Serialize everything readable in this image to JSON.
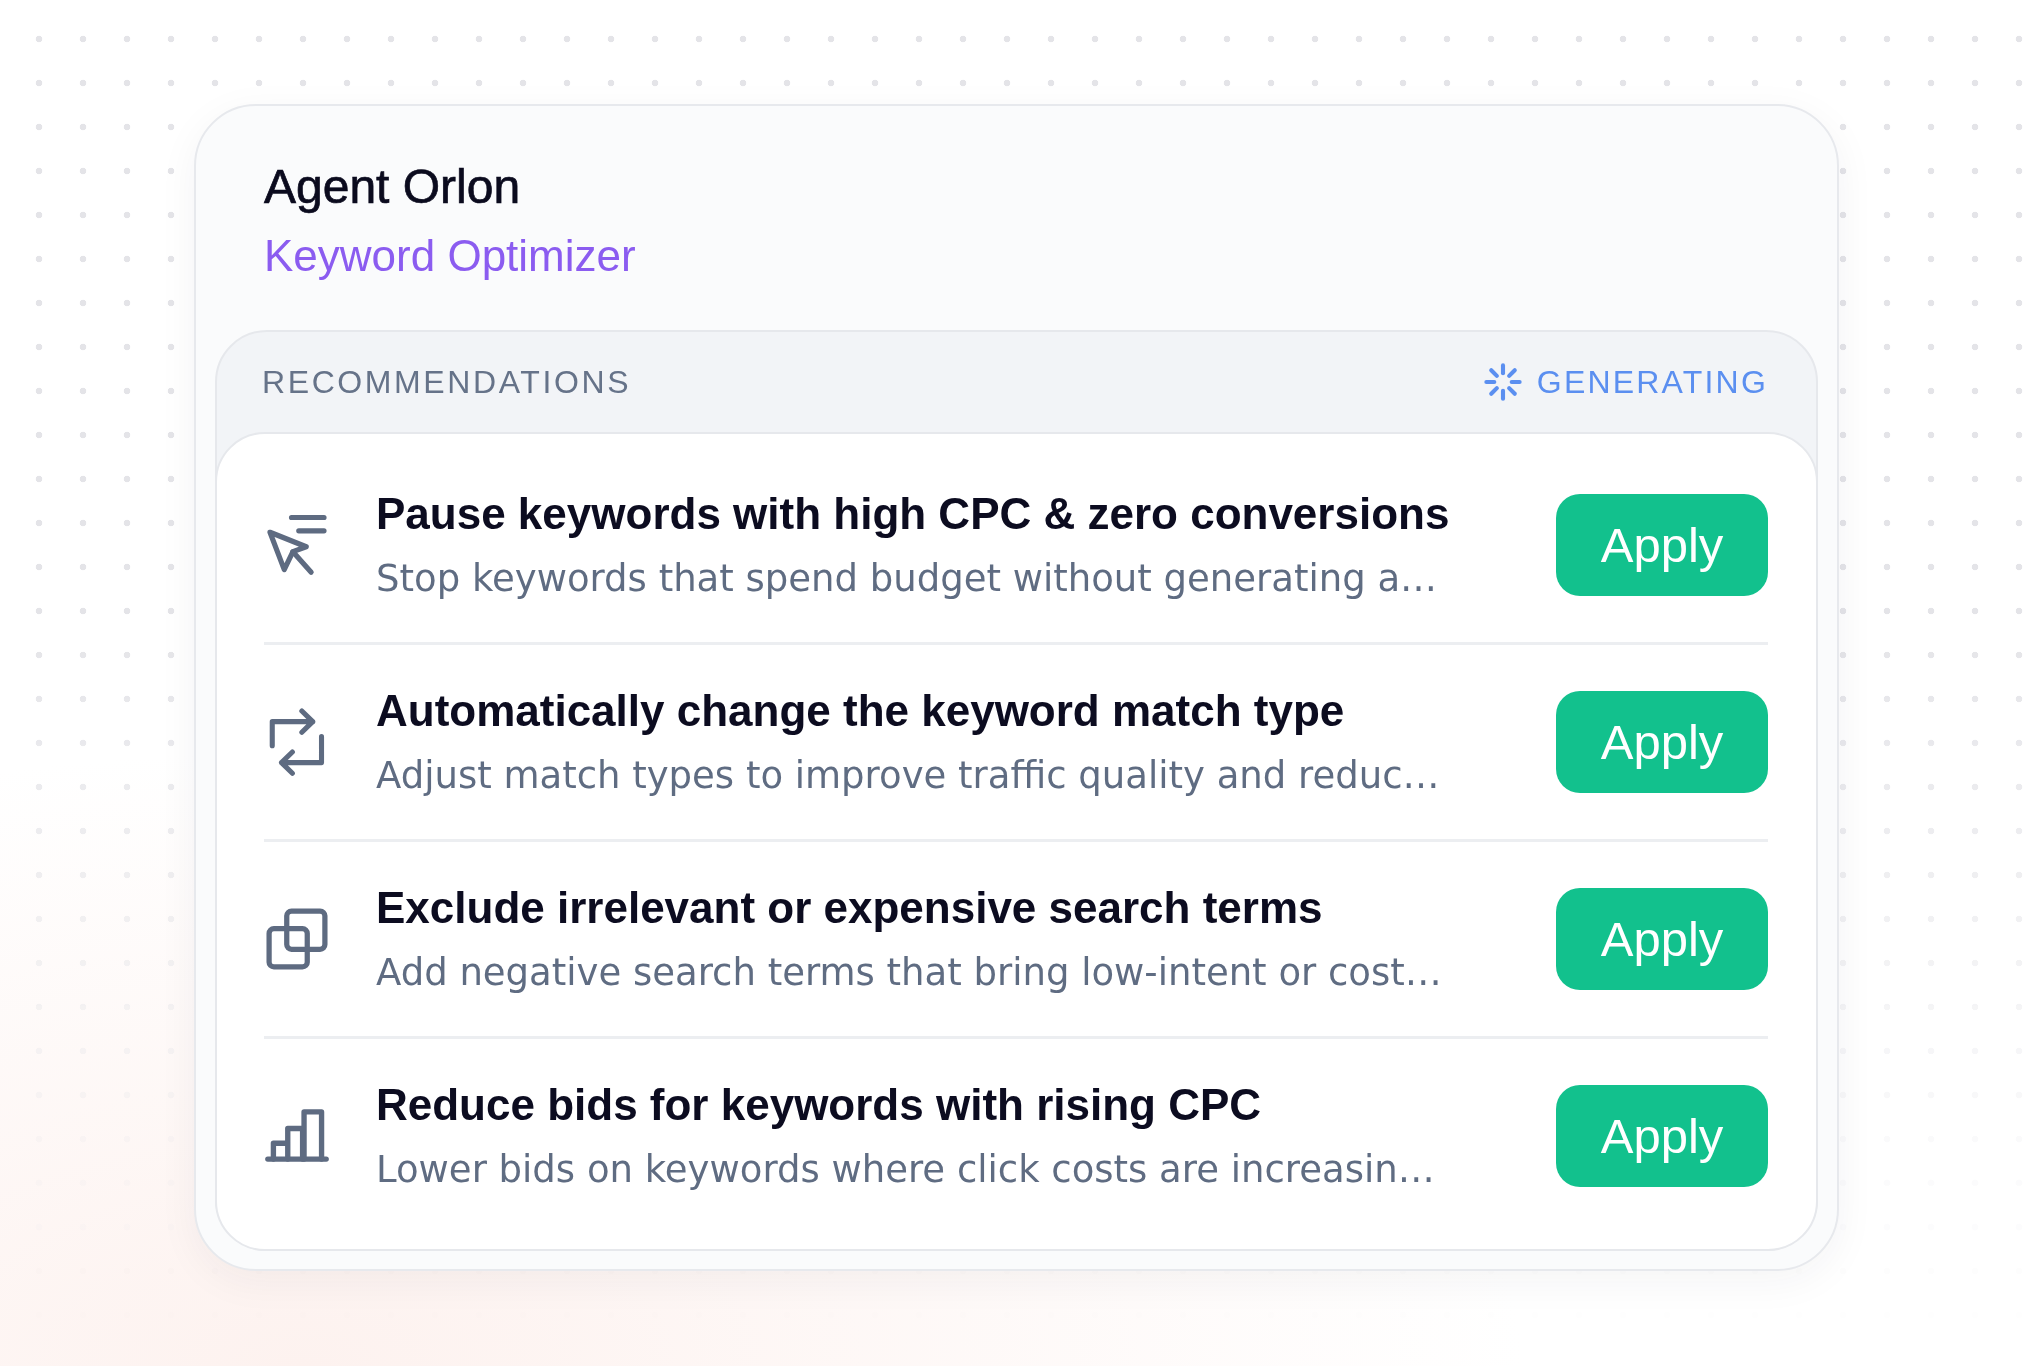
{
  "agent": {
    "name": "Agent Orlon",
    "role": "Keyword Optimizer"
  },
  "recommendations": {
    "heading": "RECOMMENDATIONS",
    "status": "GENERATING",
    "items": [
      {
        "title": "Pause keywords with high CPC & zero conversions",
        "description": "Stop keywords that spend budget without generating a…",
        "action": "Apply"
      },
      {
        "title": "Automatically change the keyword match type",
        "description": "Adjust match types to improve traffic quality and reduc…",
        "action": "Apply"
      },
      {
        "title": "Exclude irrelevant or expensive search terms",
        "description": "Add negative search terms that bring low-intent or cost…",
        "action": "Apply"
      },
      {
        "title": "Reduce bids for keywords with rising CPC",
        "description": "Lower bids on keywords where click costs are increasin…",
        "action": "Apply"
      }
    ]
  }
}
